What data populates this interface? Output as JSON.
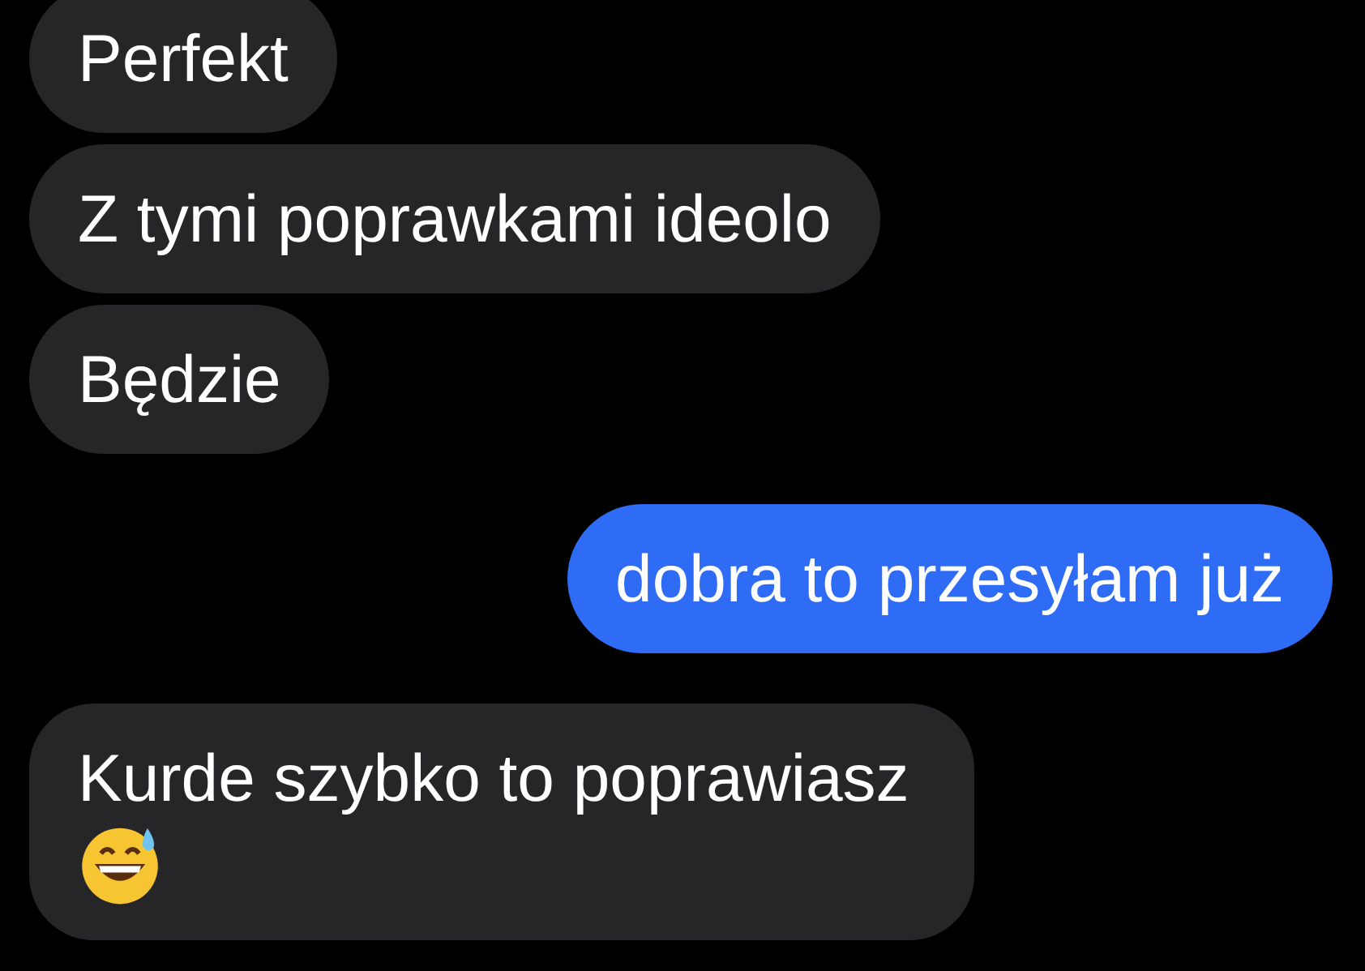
{
  "messages": [
    {
      "text": "Perfekt",
      "kind": "received",
      "has_emoji": false
    },
    {
      "text": "Z tymi poprawkami ideolo",
      "kind": "received",
      "has_emoji": false
    },
    {
      "text": "Będzie",
      "kind": "received",
      "has_emoji": false
    },
    {
      "text": "dobra to przesyłam już",
      "kind": "sent",
      "has_emoji": false
    },
    {
      "text": "Kurde szybko to poprawiasz",
      "kind": "received",
      "has_emoji": true
    }
  ]
}
